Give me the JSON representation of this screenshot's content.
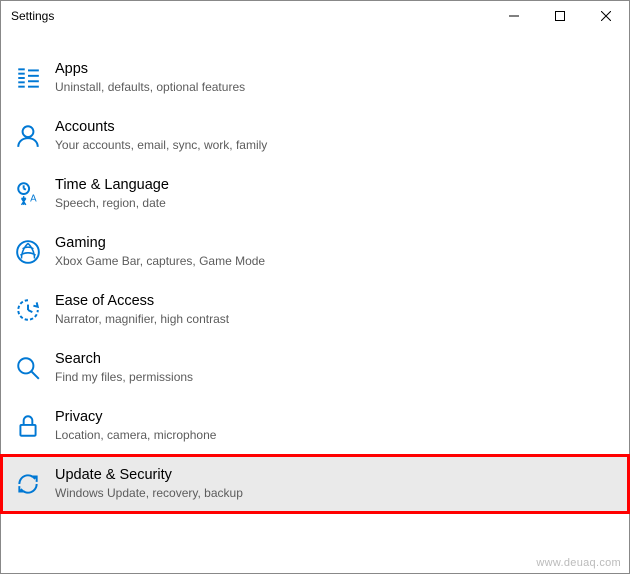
{
  "window": {
    "title": "Settings"
  },
  "items": [
    {
      "title": "Apps",
      "subtitle": "Uninstall, defaults, optional features"
    },
    {
      "title": "Accounts",
      "subtitle": "Your accounts, email, sync, work, family"
    },
    {
      "title": "Time & Language",
      "subtitle": "Speech, region, date"
    },
    {
      "title": "Gaming",
      "subtitle": "Xbox Game Bar, captures, Game Mode"
    },
    {
      "title": "Ease of Access",
      "subtitle": "Narrator, magnifier, high contrast"
    },
    {
      "title": "Search",
      "subtitle": "Find my files, permissions"
    },
    {
      "title": "Privacy",
      "subtitle": "Location, camera, microphone"
    },
    {
      "title": "Update & Security",
      "subtitle": "Windows Update, recovery, backup"
    }
  ],
  "watermark": "www.deuaq.com"
}
